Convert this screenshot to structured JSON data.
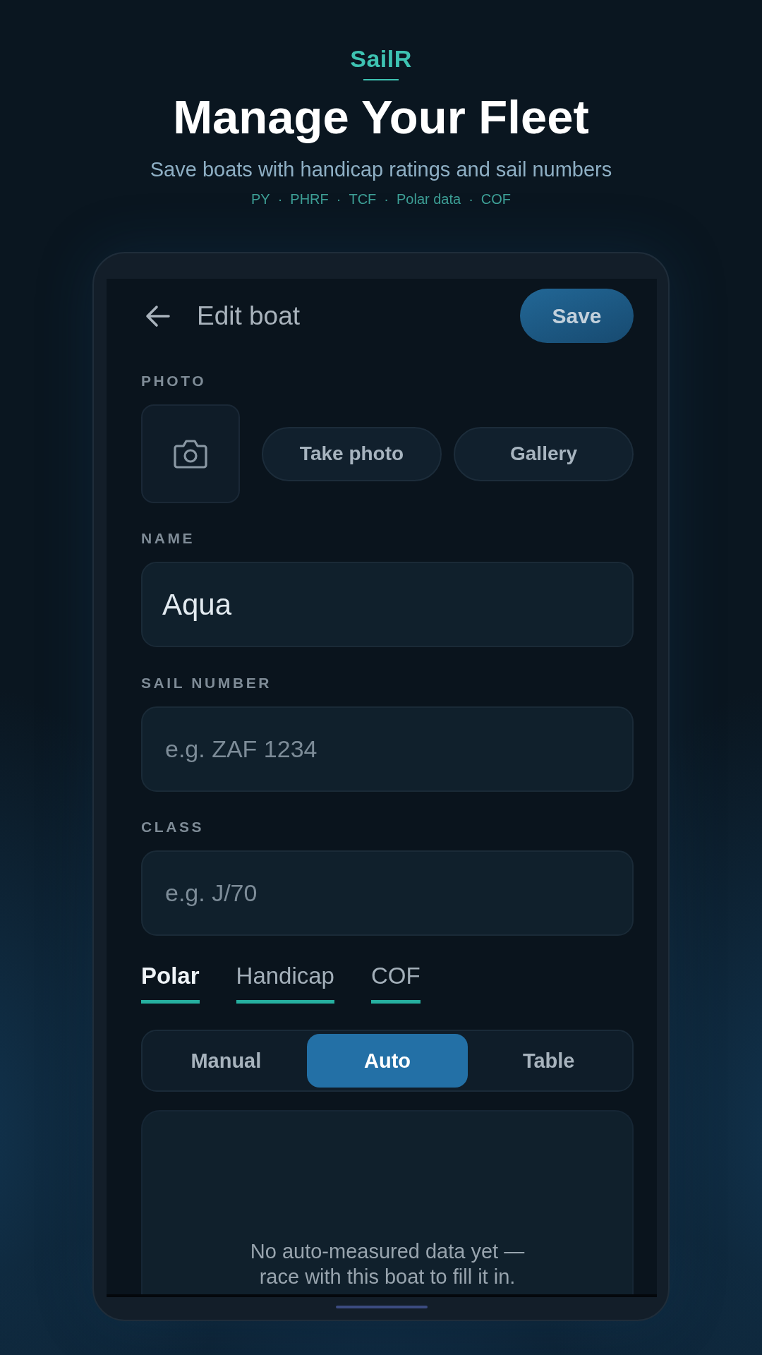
{
  "brand": {
    "name": "SailR"
  },
  "headline": "Manage Your Fleet",
  "subtitle": "Save boats with handicap ratings and sail numbers",
  "tags": {
    "items": [
      "PY",
      "PHRF",
      "TCF",
      "Polar data",
      "COF"
    ],
    "separator": "·"
  },
  "screen": {
    "header": {
      "title": "Edit boat",
      "save_button": "Save"
    },
    "photo": {
      "label": "PHOTO",
      "buttons": [
        "Take photo",
        "Gallery"
      ]
    },
    "fields": [
      {
        "label": "NAME",
        "value": "Aqua"
      },
      {
        "label": "SAIL NUMBER",
        "placeholder": "e.g. ZAF 1234"
      },
      {
        "label": "CLASS",
        "placeholder": "e.g. J/70"
      }
    ],
    "tabs": [
      {
        "label": "Polar",
        "selected": true
      },
      {
        "label": "Handicap",
        "selected": false
      },
      {
        "label": "COF",
        "selected": false
      }
    ],
    "modes": [
      {
        "label": "Manual",
        "selected": false
      },
      {
        "label": "Auto",
        "selected": true
      },
      {
        "label": "Table",
        "selected": false
      }
    ],
    "empty_message": "No auto-measured data yet — race with this boat to fill it in."
  }
}
